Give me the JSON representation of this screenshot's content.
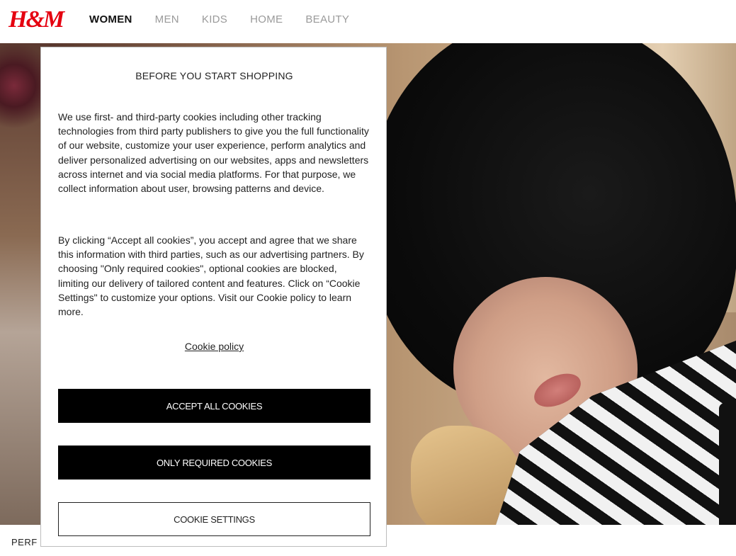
{
  "brand": {
    "logo_text": "H&M",
    "logo_color": "#e50010"
  },
  "nav": {
    "items": [
      {
        "label": "WOMEN",
        "active": true
      },
      {
        "label": "MEN",
        "active": false
      },
      {
        "label": "KIDS",
        "active": false
      },
      {
        "label": "HOME",
        "active": false
      },
      {
        "label": "BEAUTY",
        "active": false
      }
    ]
  },
  "hero": {
    "caption": "PERF"
  },
  "cookie_dialog": {
    "title": "BEFORE YOU START SHOPPING",
    "paragraph1": "We use first- and third-party cookies including other tracking technologies from third party publishers to give you the full functionality of our website, customize your user experience, perform analytics and deliver personalized advertising on our websites, apps and newsletters across internet and via social media platforms. For that purpose, we collect information about user, browsing patterns and device.",
    "paragraph2": "By clicking “Accept all cookies”, you accept and agree that we share this information with third parties, such as our advertising partners. By choosing \"Only required cookies\", optional cookies are blocked, limiting our delivery of tailored content and features. Click on “Cookie Settings\" to customize your options. Visit our Cookie policy to learn more.",
    "policy_link": "Cookie policy",
    "accept_all": "ACCEPT ALL COOKIES",
    "only_required": "ONLY REQUIRED COOKIES",
    "settings": "COOKIE SETTINGS"
  }
}
